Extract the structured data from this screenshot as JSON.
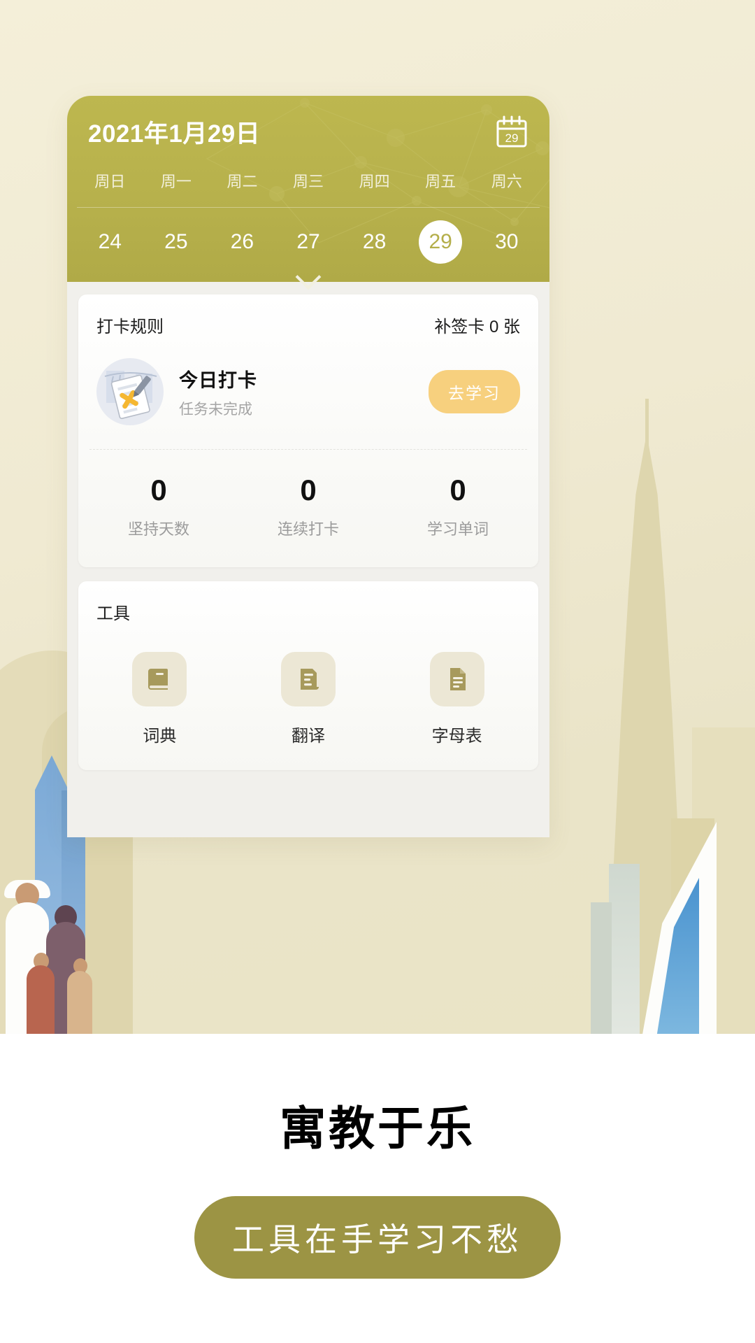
{
  "calendar": {
    "date_title": "2021年1月29日",
    "calendar_icon_label": "29",
    "weekdays": [
      "周日",
      "周一",
      "周二",
      "周三",
      "周四",
      "周五",
      "周六"
    ],
    "days": [
      "24",
      "25",
      "26",
      "27",
      "28",
      "29",
      "30"
    ],
    "selected_day": "29",
    "expand_icon": "chevron-down-icon"
  },
  "checkin_card": {
    "rules_label": "打卡规则",
    "makeup_cards": "补签卡 0 张",
    "task_title": "今日打卡",
    "task_status": "任务未完成",
    "action_button": "去学习",
    "stats": [
      {
        "value": "0",
        "label": "坚持天数"
      },
      {
        "value": "0",
        "label": "连续打卡"
      },
      {
        "value": "0",
        "label": "学习单词"
      }
    ]
  },
  "tools_card": {
    "title": "工具",
    "items": [
      {
        "label": "词典",
        "icon": "book-icon"
      },
      {
        "label": "翻译",
        "icon": "document-lines-icon"
      },
      {
        "label": "字母表",
        "icon": "file-text-icon"
      }
    ]
  },
  "promo": {
    "headline": "寓教于乐",
    "cta": "工具在手学习不愁"
  },
  "colors": {
    "header_olive": "#b7b14c",
    "cta_olive": "#9c9444",
    "accent_yellow": "#f7d07e",
    "tool_icon": "#a79a5c",
    "page_bg": "#f0ead2"
  }
}
